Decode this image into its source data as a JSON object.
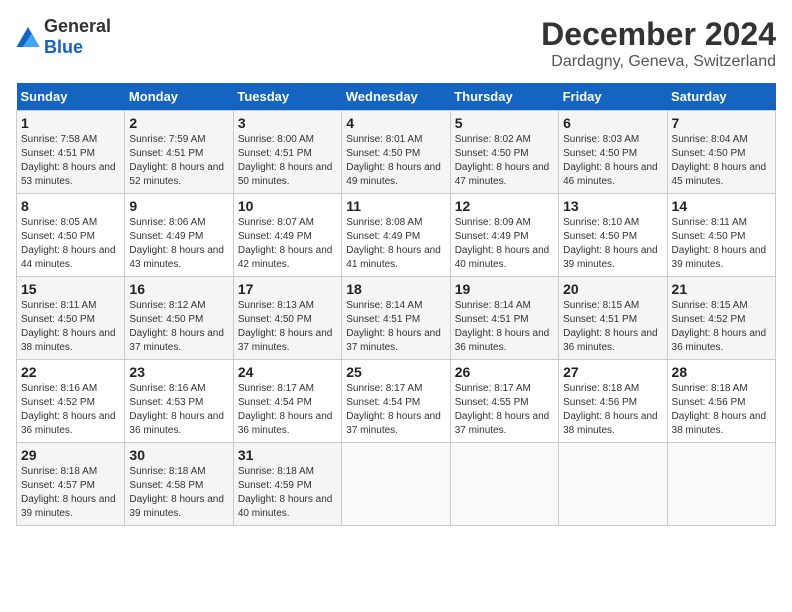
{
  "logo": {
    "general": "General",
    "blue": "Blue"
  },
  "title": "December 2024",
  "location": "Dardagny, Geneva, Switzerland",
  "days_of_week": [
    "Sunday",
    "Monday",
    "Tuesday",
    "Wednesday",
    "Thursday",
    "Friday",
    "Saturday"
  ],
  "weeks": [
    [
      {
        "day": "1",
        "sunrise": "Sunrise: 7:58 AM",
        "sunset": "Sunset: 4:51 PM",
        "daylight": "Daylight: 8 hours and 53 minutes."
      },
      {
        "day": "2",
        "sunrise": "Sunrise: 7:59 AM",
        "sunset": "Sunset: 4:51 PM",
        "daylight": "Daylight: 8 hours and 52 minutes."
      },
      {
        "day": "3",
        "sunrise": "Sunrise: 8:00 AM",
        "sunset": "Sunset: 4:51 PM",
        "daylight": "Daylight: 8 hours and 50 minutes."
      },
      {
        "day": "4",
        "sunrise": "Sunrise: 8:01 AM",
        "sunset": "Sunset: 4:50 PM",
        "daylight": "Daylight: 8 hours and 49 minutes."
      },
      {
        "day": "5",
        "sunrise": "Sunrise: 8:02 AM",
        "sunset": "Sunset: 4:50 PM",
        "daylight": "Daylight: 8 hours and 47 minutes."
      },
      {
        "day": "6",
        "sunrise": "Sunrise: 8:03 AM",
        "sunset": "Sunset: 4:50 PM",
        "daylight": "Daylight: 8 hours and 46 minutes."
      },
      {
        "day": "7",
        "sunrise": "Sunrise: 8:04 AM",
        "sunset": "Sunset: 4:50 PM",
        "daylight": "Daylight: 8 hours and 45 minutes."
      }
    ],
    [
      {
        "day": "8",
        "sunrise": "Sunrise: 8:05 AM",
        "sunset": "Sunset: 4:50 PM",
        "daylight": "Daylight: 8 hours and 44 minutes."
      },
      {
        "day": "9",
        "sunrise": "Sunrise: 8:06 AM",
        "sunset": "Sunset: 4:49 PM",
        "daylight": "Daylight: 8 hours and 43 minutes."
      },
      {
        "day": "10",
        "sunrise": "Sunrise: 8:07 AM",
        "sunset": "Sunset: 4:49 PM",
        "daylight": "Daylight: 8 hours and 42 minutes."
      },
      {
        "day": "11",
        "sunrise": "Sunrise: 8:08 AM",
        "sunset": "Sunset: 4:49 PM",
        "daylight": "Daylight: 8 hours and 41 minutes."
      },
      {
        "day": "12",
        "sunrise": "Sunrise: 8:09 AM",
        "sunset": "Sunset: 4:49 PM",
        "daylight": "Daylight: 8 hours and 40 minutes."
      },
      {
        "day": "13",
        "sunrise": "Sunrise: 8:10 AM",
        "sunset": "Sunset: 4:50 PM",
        "daylight": "Daylight: 8 hours and 39 minutes."
      },
      {
        "day": "14",
        "sunrise": "Sunrise: 8:11 AM",
        "sunset": "Sunset: 4:50 PM",
        "daylight": "Daylight: 8 hours and 39 minutes."
      }
    ],
    [
      {
        "day": "15",
        "sunrise": "Sunrise: 8:11 AM",
        "sunset": "Sunset: 4:50 PM",
        "daylight": "Daylight: 8 hours and 38 minutes."
      },
      {
        "day": "16",
        "sunrise": "Sunrise: 8:12 AM",
        "sunset": "Sunset: 4:50 PM",
        "daylight": "Daylight: 8 hours and 37 minutes."
      },
      {
        "day": "17",
        "sunrise": "Sunrise: 8:13 AM",
        "sunset": "Sunset: 4:50 PM",
        "daylight": "Daylight: 8 hours and 37 minutes."
      },
      {
        "day": "18",
        "sunrise": "Sunrise: 8:14 AM",
        "sunset": "Sunset: 4:51 PM",
        "daylight": "Daylight: 8 hours and 37 minutes."
      },
      {
        "day": "19",
        "sunrise": "Sunrise: 8:14 AM",
        "sunset": "Sunset: 4:51 PM",
        "daylight": "Daylight: 8 hours and 36 minutes."
      },
      {
        "day": "20",
        "sunrise": "Sunrise: 8:15 AM",
        "sunset": "Sunset: 4:51 PM",
        "daylight": "Daylight: 8 hours and 36 minutes."
      },
      {
        "day": "21",
        "sunrise": "Sunrise: 8:15 AM",
        "sunset": "Sunset: 4:52 PM",
        "daylight": "Daylight: 8 hours and 36 minutes."
      }
    ],
    [
      {
        "day": "22",
        "sunrise": "Sunrise: 8:16 AM",
        "sunset": "Sunset: 4:52 PM",
        "daylight": "Daylight: 8 hours and 36 minutes."
      },
      {
        "day": "23",
        "sunrise": "Sunrise: 8:16 AM",
        "sunset": "Sunset: 4:53 PM",
        "daylight": "Daylight: 8 hours and 36 minutes."
      },
      {
        "day": "24",
        "sunrise": "Sunrise: 8:17 AM",
        "sunset": "Sunset: 4:54 PM",
        "daylight": "Daylight: 8 hours and 36 minutes."
      },
      {
        "day": "25",
        "sunrise": "Sunrise: 8:17 AM",
        "sunset": "Sunset: 4:54 PM",
        "daylight": "Daylight: 8 hours and 37 minutes."
      },
      {
        "day": "26",
        "sunrise": "Sunrise: 8:17 AM",
        "sunset": "Sunset: 4:55 PM",
        "daylight": "Daylight: 8 hours and 37 minutes."
      },
      {
        "day": "27",
        "sunrise": "Sunrise: 8:18 AM",
        "sunset": "Sunset: 4:56 PM",
        "daylight": "Daylight: 8 hours and 38 minutes."
      },
      {
        "day": "28",
        "sunrise": "Sunrise: 8:18 AM",
        "sunset": "Sunset: 4:56 PM",
        "daylight": "Daylight: 8 hours and 38 minutes."
      }
    ],
    [
      {
        "day": "29",
        "sunrise": "Sunrise: 8:18 AM",
        "sunset": "Sunset: 4:57 PM",
        "daylight": "Daylight: 8 hours and 39 minutes."
      },
      {
        "day": "30",
        "sunrise": "Sunrise: 8:18 AM",
        "sunset": "Sunset: 4:58 PM",
        "daylight": "Daylight: 8 hours and 39 minutes."
      },
      {
        "day": "31",
        "sunrise": "Sunrise: 8:18 AM",
        "sunset": "Sunset: 4:59 PM",
        "daylight": "Daylight: 8 hours and 40 minutes."
      },
      null,
      null,
      null,
      null
    ]
  ]
}
